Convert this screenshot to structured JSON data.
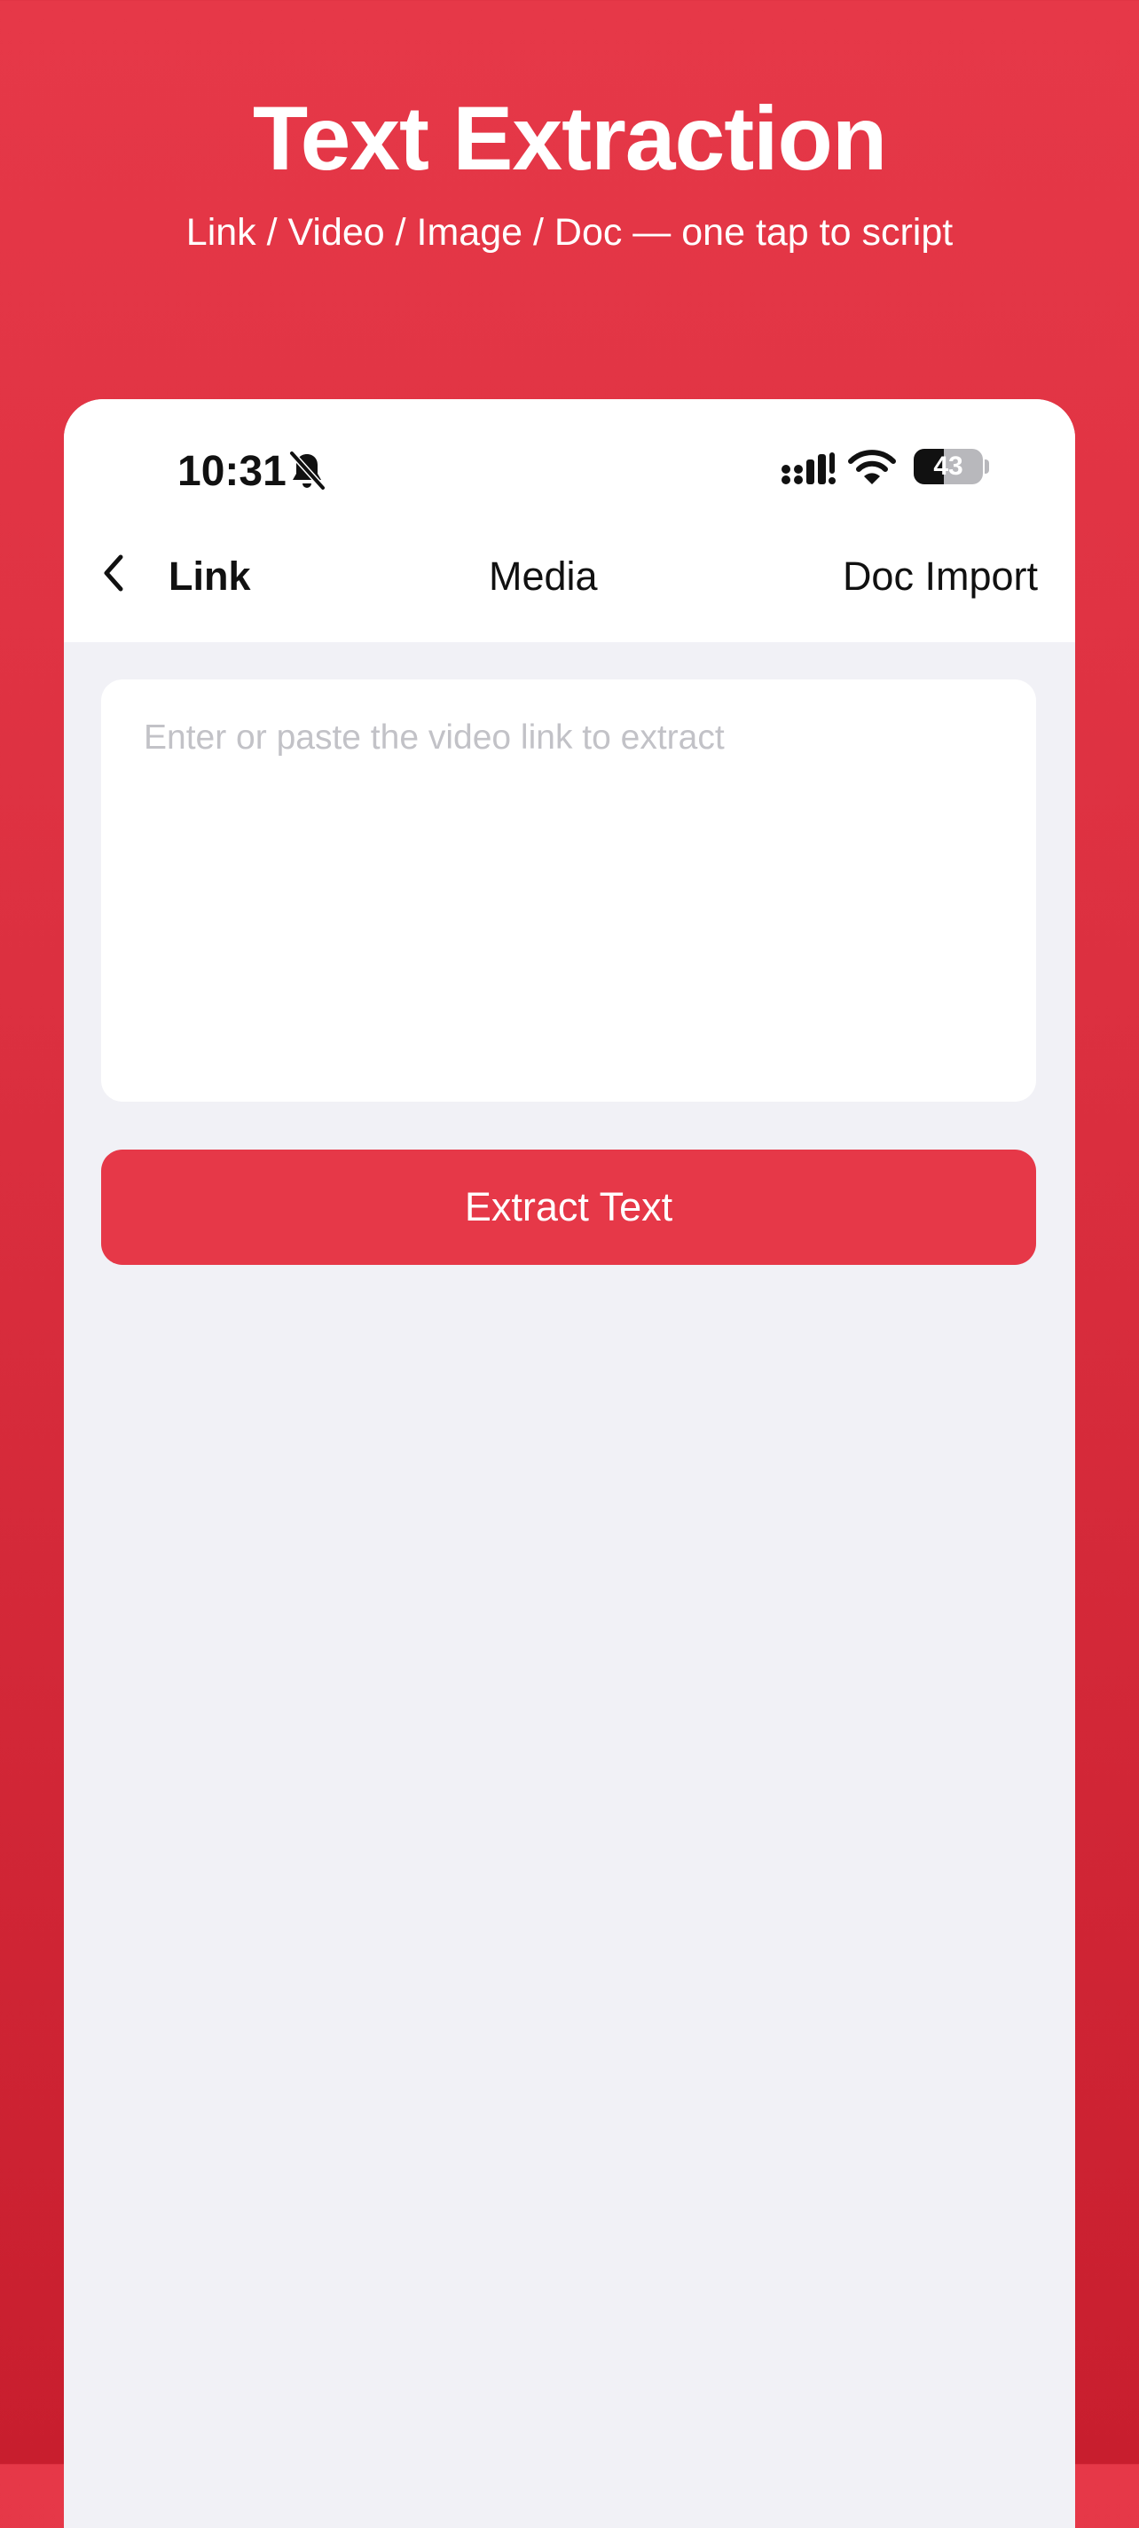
{
  "promo": {
    "title": "Text Extraction",
    "subtitle": "Link / Video / Image / Doc — one tap to script"
  },
  "status_bar": {
    "time": "10:31",
    "battery_level": "43",
    "icons": [
      "bell-slash-icon",
      "cellular-signal-icon",
      "wifi-icon",
      "battery-icon"
    ]
  },
  "nav": {
    "back_icon": "chevron-left-icon",
    "tabs": [
      {
        "label": "Link",
        "selected": true
      },
      {
        "label": "Media",
        "selected": false
      },
      {
        "label": "Doc Import",
        "selected": false
      }
    ]
  },
  "link_input": {
    "value": "",
    "placeholder": "Enter or paste the video link to extract"
  },
  "extract_button": {
    "label": "Extract Text"
  },
  "colors": {
    "accent": "#e63848",
    "background_top": "#e63848",
    "background_bottom": "#c81e2e",
    "content_background": "#f1f1f6"
  }
}
